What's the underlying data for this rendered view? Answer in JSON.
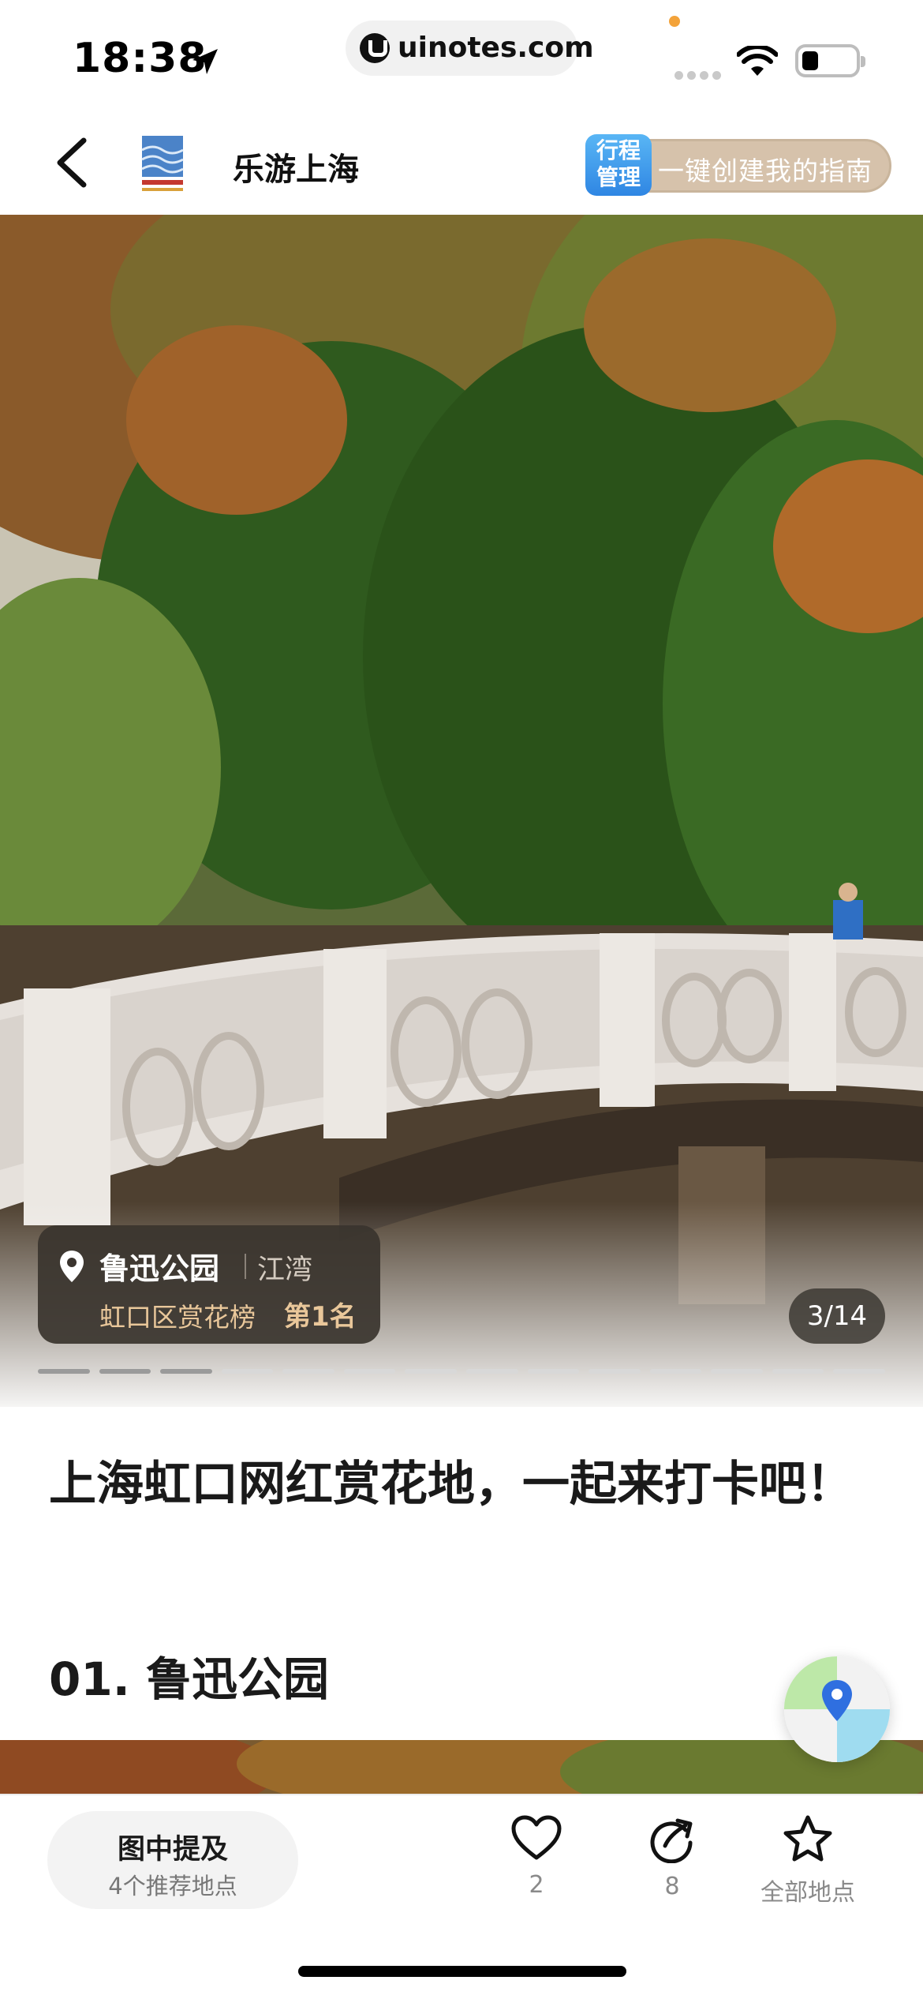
{
  "status_bar": {
    "time": "18:38",
    "url": "uinotes.com"
  },
  "nav": {
    "title": "乐游上海",
    "cta_badge": "行程\n管理",
    "cta_text": "一键创建我的指南"
  },
  "hero": {
    "poi_name": "鲁迅公园",
    "poi_area": "江湾",
    "poi_rank": "虹口区赏花榜",
    "poi_rank_num": "第1名",
    "counter": "3/14",
    "image_index": 3,
    "image_total": 14
  },
  "article": {
    "title": "上海虹口网红赏花地，一起来打卡吧！",
    "section_title": "01. 鲁迅公园"
  },
  "bottom_bar": {
    "mention_title": "图中提及",
    "mention_sub": "4个推荐地点",
    "like_count": "2",
    "share_count": "8",
    "all_places_label": "全部地点"
  },
  "colors": {
    "cta_pill": "#d6c2ab",
    "cta_badge": "#2f86e3",
    "rank_gold": "#e9c79a",
    "poi_card": "#3a342e"
  },
  "icons": [
    "back-icon",
    "location-arrow-icon",
    "wifi-icon",
    "battery-icon",
    "pin-icon",
    "map-pin-icon",
    "heart-icon",
    "share-icon",
    "star-icon"
  ]
}
